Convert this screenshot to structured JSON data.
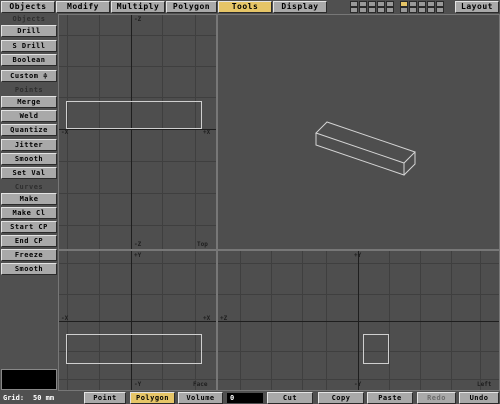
{
  "top_tabs": [
    {
      "label": "Objects"
    },
    {
      "label": "Modify"
    },
    {
      "label": "Multiply"
    },
    {
      "label": "Polygon"
    },
    {
      "label": "Tools"
    },
    {
      "label": "Display"
    }
  ],
  "layout_button": "Layout",
  "side": {
    "objects_header": "Objects",
    "objects": [
      "Drill",
      "S Drill",
      "Boolean"
    ],
    "custom": "Custom ≑",
    "points_header": "Points",
    "points": [
      "Merge",
      "Weld",
      "Quantize",
      "Jitter",
      "Smooth",
      "Set Val"
    ],
    "curves_header": "Curves",
    "curves": [
      "Make",
      "Make Cl",
      "Start CP",
      "End CP",
      "Freeze",
      "Smooth"
    ]
  },
  "viewports": {
    "top": {
      "up": "-Z",
      "left": "-X",
      "right": "+X",
      "down": "-Z",
      "name": "Top"
    },
    "face": {
      "up": "+Y",
      "left": "-X",
      "right": "+X",
      "down": "-Y",
      "name": "Face"
    },
    "left": {
      "up": "+Y",
      "left": "+Z",
      "down": "-Y",
      "name": "Left"
    }
  },
  "bottom": {
    "grid_label": "Grid:",
    "grid_value": "50 mm",
    "modes": [
      "Point",
      "Polygon",
      "Volume"
    ],
    "count": "0",
    "actions": [
      "Cut",
      "Copy",
      "Paste",
      "Redo",
      "Undo"
    ]
  },
  "colors": {
    "accent": "#e6c567",
    "button": "#a9a9a9",
    "background": "#505050"
  }
}
